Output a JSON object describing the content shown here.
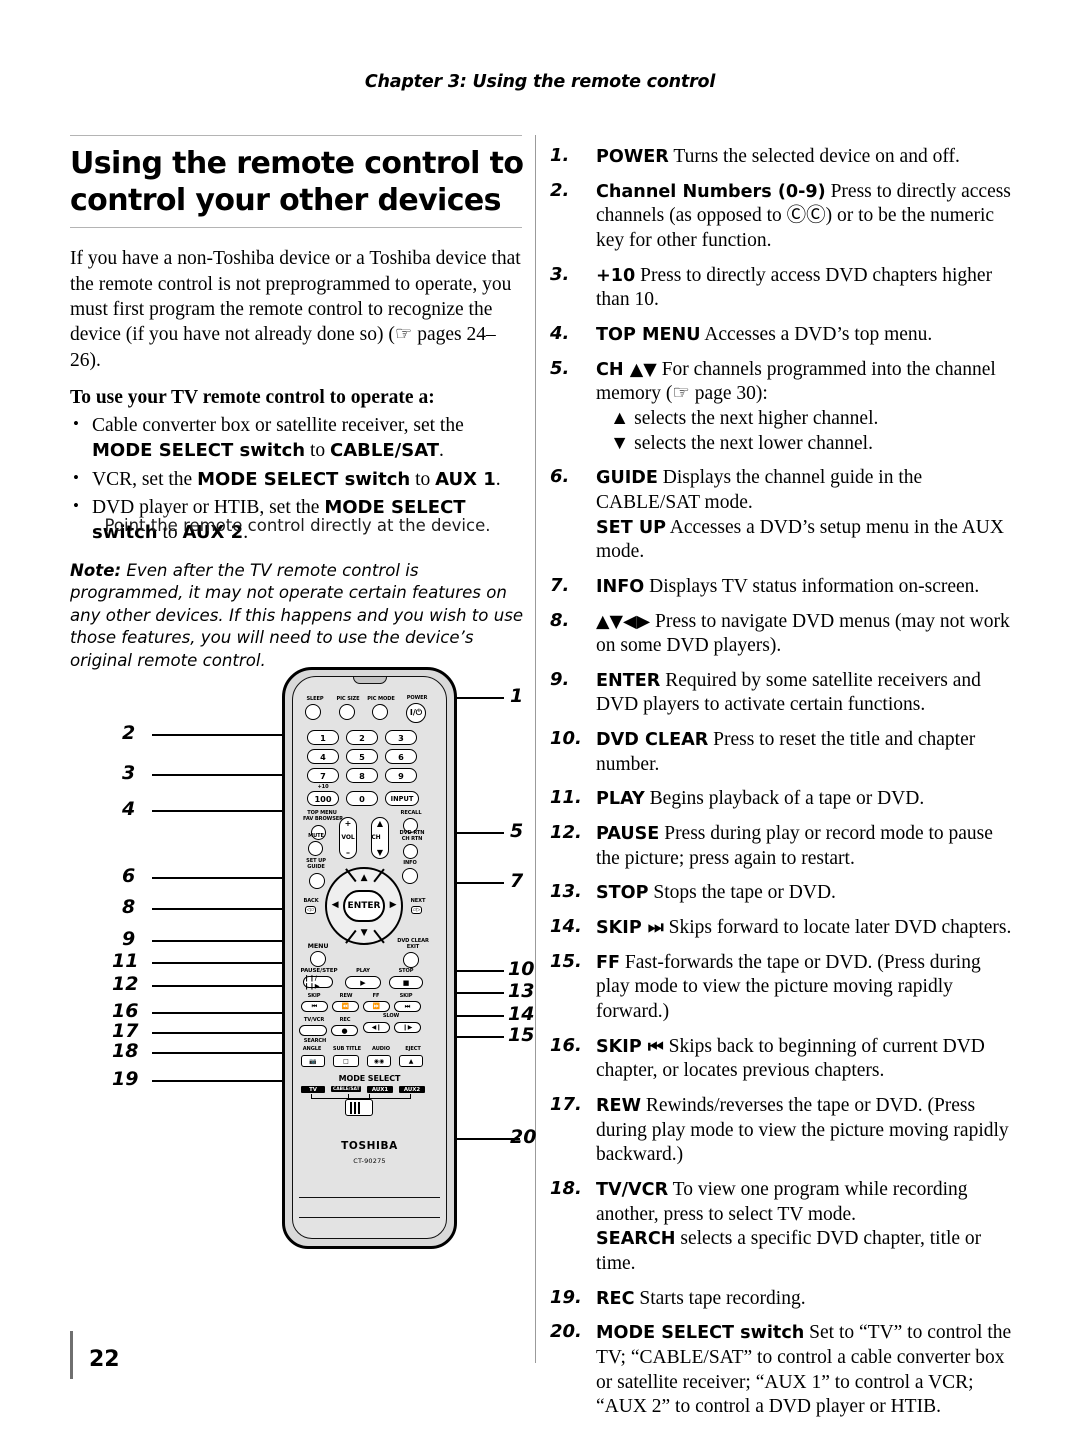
{
  "header": {
    "chapter": "Chapter 3: Using the remote control"
  },
  "page": {
    "number": "22"
  },
  "left": {
    "title": "Using the remote control to control your other devices",
    "intro": "If you have a non-Toshiba device or a Toshiba device that the remote control is not preprogrammed to operate, you must first program the remote control to recognize the device (if you have not already done so) (☞ pages 24–26).",
    "subhead": "To use your TV remote control to operate a:",
    "bullets": [
      {
        "pre": "Cable converter box or satellite receiver, set the ",
        "b1": "MODE SELECT switch",
        "mid": " to ",
        "b2": "CABLE/SAT",
        "post": "."
      },
      {
        "pre": "VCR, set the ",
        "b1": "MODE SELECT switch",
        "mid": " to ",
        "b2": "AUX 1",
        "post": "."
      },
      {
        "pre": "DVD player or HTIB, set the ",
        "b1": "MODE SELECT switch",
        "mid": " to ",
        "b2": "AUX 2",
        "post": "."
      }
    ],
    "note_label": "Note:",
    "note_text": " Even after the TV remote control is programmed, it may not operate certain features on any other devices. If this happens and you wish to use those features, you will need to use the device’s original remote control.",
    "remote_caption": "Point the remote control directly at the device."
  },
  "functions": [
    {
      "n": "1.",
      "lead": "POWER",
      "text": " Turns the selected device on and off."
    },
    {
      "n": "2.",
      "lead": "Channel Numbers (0-9)",
      "text": " Press to directly access channels (as opposed to ⒸⒸ) or to be the numeric key for other function."
    },
    {
      "n": "3.",
      "lead": "+10",
      "text": " Press to directly access DVD chapters higher than 10."
    },
    {
      "n": "4.",
      "lead": "TOP MENU",
      "text": " Accesses a DVD’s top menu."
    },
    {
      "n": "5.",
      "lead": "CH ▲▼",
      "text": " For channels programmed into the channel memory (☞ page 30):",
      "sub1": "▲ selects the next higher channel.",
      "sub2": "▼ selects the next lower channel."
    },
    {
      "n": "6.",
      "lead": "GUIDE",
      "text": " Displays the channel guide in the CABLE/SAT mode.",
      "lead2": "SET UP",
      "text2": " Accesses a DVD’s setup menu in the AUX mode."
    },
    {
      "n": "7.",
      "lead": "INFO",
      "text": " Displays TV status information on-screen."
    },
    {
      "n": "8.",
      "lead": "▲▼◀▶",
      "text": " Press to navigate DVD menus (may not work on some DVD players)."
    },
    {
      "n": "9.",
      "lead": "ENTER",
      "text": " Required by some satellite receivers and DVD players to activate certain functions."
    },
    {
      "n": "10.",
      "lead": "DVD CLEAR",
      "text": " Press to reset the title and chapter number."
    },
    {
      "n": "11.",
      "lead": "PLAY",
      "text": " Begins playback of a tape or DVD."
    },
    {
      "n": "12.",
      "lead": "PAUSE",
      "text": " Press during play or record mode to pause the picture; press again to restart."
    },
    {
      "n": "13.",
      "lead": "STOP",
      "text": " Stops the tape or DVD."
    },
    {
      "n": "14.",
      "lead": "SKIP ⏭",
      "text": " Skips forward to locate later DVD chapters."
    },
    {
      "n": "15.",
      "lead": "FF",
      "text": " Fast-forwards the tape or DVD. (Press during play mode to view the picture moving rapidly forward.)"
    },
    {
      "n": "16.",
      "lead": "SKIP ⏮",
      "text": " Skips back to beginning of current DVD chapter, or locates previous chapters."
    },
    {
      "n": "17.",
      "lead": "REW",
      "text": " Rewinds/reverses the tape or DVD. (Press during play mode to view the picture moving rapidly backward.)"
    },
    {
      "n": "18.",
      "lead": "TV/VCR",
      "text": " To view one program while recording another, press to select TV mode.",
      "lead2": "SEARCH",
      "text2": " selects a specific DVD chapter, title or time."
    },
    {
      "n": "19.",
      "lead": "REC",
      "text": " Starts tape recording."
    },
    {
      "n": "20.",
      "lead": "MODE SELECT switch",
      "text": " Set to “TV” to control the TV; “CABLE/SAT” to control a cable converter box or satellite receiver; “AUX 1” to control a VCR; “AUX 2” to control a DVD player or HTIB."
    }
  ],
  "remote": {
    "brand": "TOSHIBA",
    "model": "CT-90275",
    "labels": {
      "sleep": "SLEEP",
      "pic_size": "PIC SIZE",
      "pic_mode": "PIC MODE",
      "power": "POWER",
      "plus10": "+10",
      "hundred": "100",
      "input": "INPUT",
      "top_menu": "TOP MENU",
      "fav_browser": "FAV BROWSER",
      "recall": "RECALL",
      "mute": "MUTE",
      "vol": "VOL",
      "ch": "CH",
      "dvd_rtn": "DVD RTN",
      "ch_rtn": "CH RTN",
      "set_up": "SET UP",
      "guide": "GUIDE",
      "info": "INFO",
      "back": "BACK",
      "next": "NEXT",
      "enter": "ENTER",
      "menu": "MENU",
      "dvd_clear": "DVD CLEAR",
      "exit": "EXIT",
      "pause_step": "PAUSE/STEP",
      "play": "PLAY",
      "stop": "STOP",
      "skip_back": "SKIP",
      "rew": "REW",
      "ff": "FF",
      "skip_fwd": "SKIP",
      "tv_vcr": "TV/VCR",
      "rec": "REC",
      "slow": "SLOW",
      "search": "SEARCH",
      "angle": "ANGLE",
      "sub_title": "SUB TITLE",
      "audio": "AUDIO",
      "eject": "EJECT",
      "mode_select": "MODE SELECT",
      "mode_tv": "TV",
      "mode_cable": "CABLE/SAT",
      "mode_aux1": "AUX1",
      "mode_aux2": "AUX2"
    },
    "keypad": [
      "1",
      "2",
      "3",
      "4",
      "5",
      "6",
      "7",
      "8",
      "9"
    ],
    "zero": "0",
    "callouts_left": [
      "2",
      "3",
      "4",
      "6",
      "8",
      "9",
      "11",
      "12",
      "16",
      "17",
      "18",
      "19"
    ],
    "callouts_right": [
      "1",
      "5",
      "7",
      "10",
      "13",
      "14",
      "15",
      "20"
    ]
  }
}
